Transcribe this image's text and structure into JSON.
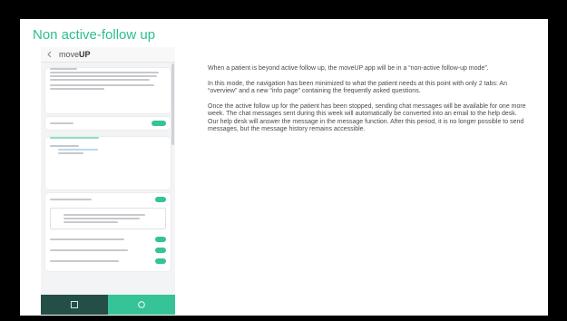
{
  "slide": {
    "title": "Non active-follow up",
    "paragraphs": [
      "When a patient is beyond active follow up, the moveUP app will be in a “non-active follow-up mode”.",
      "In this mode, the navigation has been minimized to what the patient needs at this point with only 2 tabs: An “overview” and a new “info page” containing the frequently asked questions.",
      "Once the active follow up for the patient has been stopped, sending chat messages will be available for one more week. The chat messages sent during this week will automatically be converted into an email to the help desk. Our help desk will answer the message in the message function. After this period, it is no longer possible to send messages, but the message history remains accessible."
    ]
  },
  "phone": {
    "logo_prefix": "move",
    "logo_suffix": "UP",
    "colors": {
      "accent": "#35c397",
      "tab_active": "#244f46",
      "tab_inactive": "#35c397",
      "background": "#f3f4f5"
    },
    "tabs": [
      "overview-icon",
      "info-icon"
    ]
  }
}
